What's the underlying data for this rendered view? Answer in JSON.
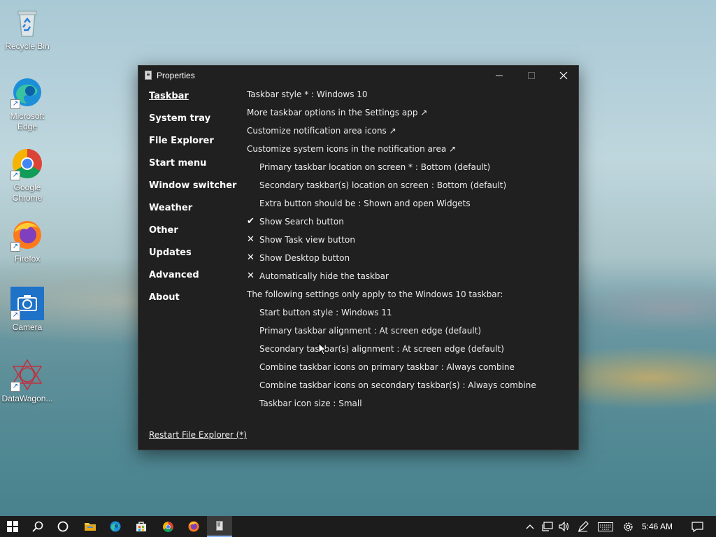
{
  "desktop": {
    "icons": [
      {
        "label": "Recycle Bin"
      },
      {
        "label": "Microsoft Edge"
      },
      {
        "label": "Google Chrome"
      },
      {
        "label": "Firefox"
      },
      {
        "label": "Camera"
      },
      {
        "label": "DataWagon..."
      }
    ]
  },
  "window": {
    "title": "Properties",
    "sidebar": [
      {
        "label": "Taskbar",
        "active": true
      },
      {
        "label": "System tray"
      },
      {
        "label": "File Explorer"
      },
      {
        "label": "Start menu"
      },
      {
        "label": "Window switcher"
      },
      {
        "label": "Weather"
      },
      {
        "label": "Other"
      },
      {
        "label": "Updates"
      },
      {
        "label": "Advanced"
      },
      {
        "label": "About"
      }
    ],
    "settings": [
      {
        "text": "Taskbar style * : Windows 10",
        "indent": false,
        "mark": ""
      },
      {
        "text": "More taskbar options in the Settings app ↗",
        "indent": false,
        "mark": ""
      },
      {
        "text": "Customize notification area icons ↗",
        "indent": false,
        "mark": ""
      },
      {
        "text": "Customize system icons in the notification area ↗",
        "indent": false,
        "mark": ""
      },
      {
        "text": "Primary taskbar location on screen * : Bottom (default)",
        "indent": true,
        "mark": ""
      },
      {
        "text": "Secondary taskbar(s) location on screen : Bottom (default)",
        "indent": true,
        "mark": ""
      },
      {
        "text": "Extra button should be : Shown and open Widgets",
        "indent": true,
        "mark": ""
      },
      {
        "text": "Show Search button",
        "indent": true,
        "mark": "✔"
      },
      {
        "text": "Show Task view button",
        "indent": true,
        "mark": "✕"
      },
      {
        "text": "Show Desktop button",
        "indent": true,
        "mark": "✕"
      },
      {
        "text": "Automatically hide the taskbar",
        "indent": true,
        "mark": "✕"
      },
      {
        "text": "The following settings only apply to the Windows 10 taskbar:",
        "indent": false,
        "mark": ""
      },
      {
        "text": "Start button style : Windows 11",
        "indent": true,
        "mark": ""
      },
      {
        "text": "Primary taskbar alignment : At screen edge (default)",
        "indent": true,
        "mark": ""
      },
      {
        "text": "Secondary taskbar(s) alignment : At screen edge (default)",
        "indent": true,
        "mark": ""
      },
      {
        "text": "Combine taskbar icons on primary taskbar : Always combine",
        "indent": true,
        "mark": ""
      },
      {
        "text": "Combine taskbar icons on secondary taskbar(s) : Always combine",
        "indent": true,
        "mark": ""
      },
      {
        "text": "Taskbar icon size : Small",
        "indent": true,
        "mark": ""
      }
    ],
    "restart_link": "Restart File Explorer (*)"
  },
  "taskbar": {
    "clock": "5:46 AM"
  }
}
